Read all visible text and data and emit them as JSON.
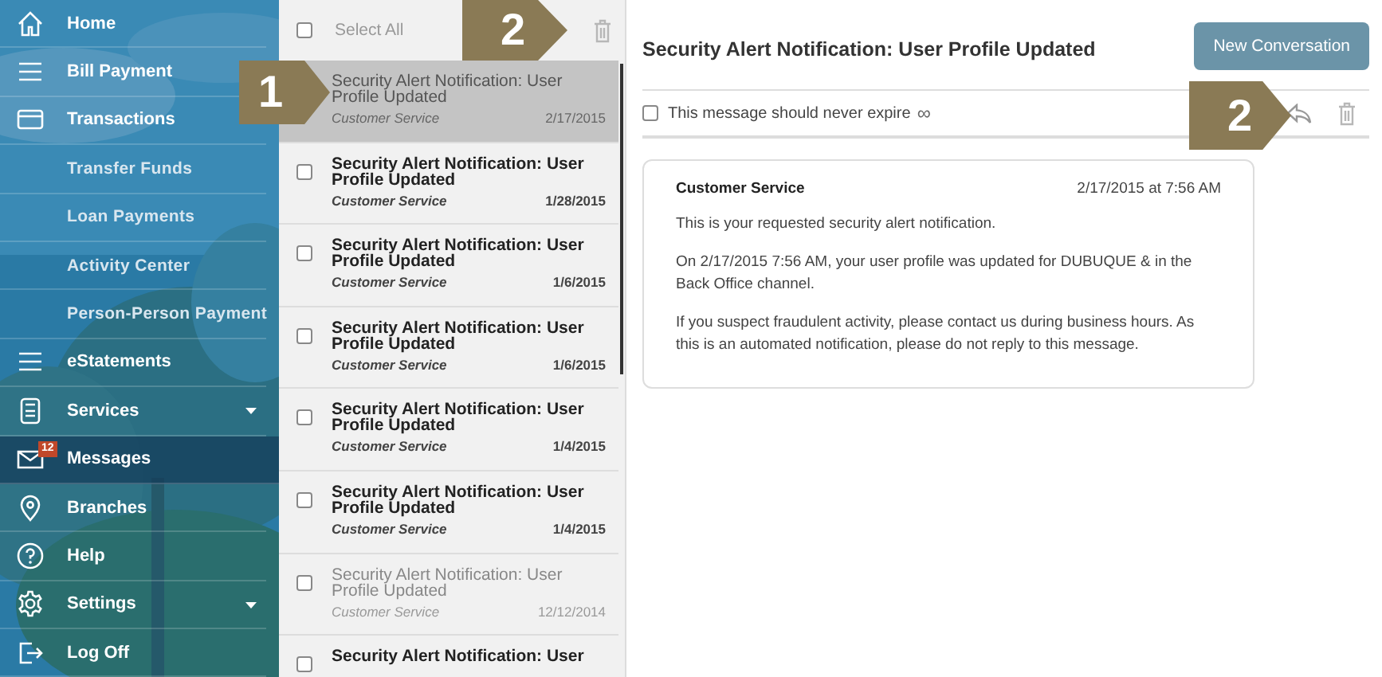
{
  "sidebar": {
    "items": [
      {
        "label": "Home",
        "selected": false
      },
      {
        "label": "Bill Payment",
        "selected": false
      },
      {
        "label": "Transactions",
        "selected": false,
        "kind": "dropdown",
        "children": [
          {
            "label": "Transfer Funds",
            "selected": false
          },
          {
            "label": "Loan Payments",
            "selected": false
          },
          {
            "label": "Activity Center",
            "selected": false
          },
          {
            "label": "Person-Person Payment",
            "selected": false
          }
        ]
      },
      {
        "label": "eStatements",
        "selected": false
      },
      {
        "label": "Services",
        "selected": false,
        "kind": "dropdown"
      },
      {
        "label": "Messages",
        "selected": true,
        "badge": "12"
      },
      {
        "label": "Branches",
        "selected": false
      },
      {
        "label": "Help",
        "selected": false
      },
      {
        "label": "Settings",
        "selected": false,
        "kind": "dropdown"
      },
      {
        "label": "Log Off",
        "selected": false
      }
    ]
  },
  "message_list": {
    "select_all": {
      "label": "Select All",
      "checked": false
    },
    "items": [
      {
        "subject": "Security Alert Notification: User Profile Updated",
        "sender": "Customer Service",
        "date": "2/17/2015",
        "selected": true,
        "unread": false
      },
      {
        "subject": "Security Alert Notification: User Profile Updated",
        "sender": "Customer Service",
        "date": "1/28/2015",
        "selected": false,
        "unread": true,
        "checked": false
      },
      {
        "subject": "Security Alert Notification: User Profile Updated",
        "sender": "Customer Service",
        "date": "1/6/2015",
        "selected": false,
        "unread": true,
        "checked": false
      },
      {
        "subject": "Security Alert Notification: User Profile Updated",
        "sender": "Customer Service",
        "date": "1/6/2015",
        "selected": false,
        "unread": true,
        "checked": false
      },
      {
        "subject": "Security Alert Notification: User Profile Updated",
        "sender": "Customer Service",
        "date": "1/4/2015",
        "selected": false,
        "unread": true,
        "checked": false
      },
      {
        "subject": "Security Alert Notification: User Profile Updated",
        "sender": "Customer Service",
        "date": "1/4/2015",
        "selected": false,
        "unread": true,
        "checked": false
      },
      {
        "subject": "Security Alert Notification: User Profile Updated",
        "sender": "Customer Service",
        "date": "12/12/2014",
        "selected": false,
        "unread": false,
        "checked": false
      },
      {
        "subject": "Security Alert Notification: User",
        "selected": false,
        "unread": true,
        "checked": false
      }
    ]
  },
  "message": {
    "title": "Security Alert Notification: User Profile Updated",
    "new_button": "New Conversation",
    "never_expire": {
      "label": "This message should never expire",
      "symbol": "∞",
      "checked": false
    },
    "sender": "Customer Service",
    "timestamp": "2/17/2015 at 7:56 AM",
    "paragraphs": [
      "This is your requested security alert notification.",
      "On 2/17/2015 7:56 AM, your user profile was updated for DUBUQUE & in the Back Office channel.",
      "If you suspect fraudulent activity, please contact us during business hours. As this is an automated notification, please do not reply to this message."
    ]
  },
  "callouts": [
    {
      "number": "1"
    },
    {
      "number": "2"
    },
    {
      "number": "2"
    }
  ]
}
